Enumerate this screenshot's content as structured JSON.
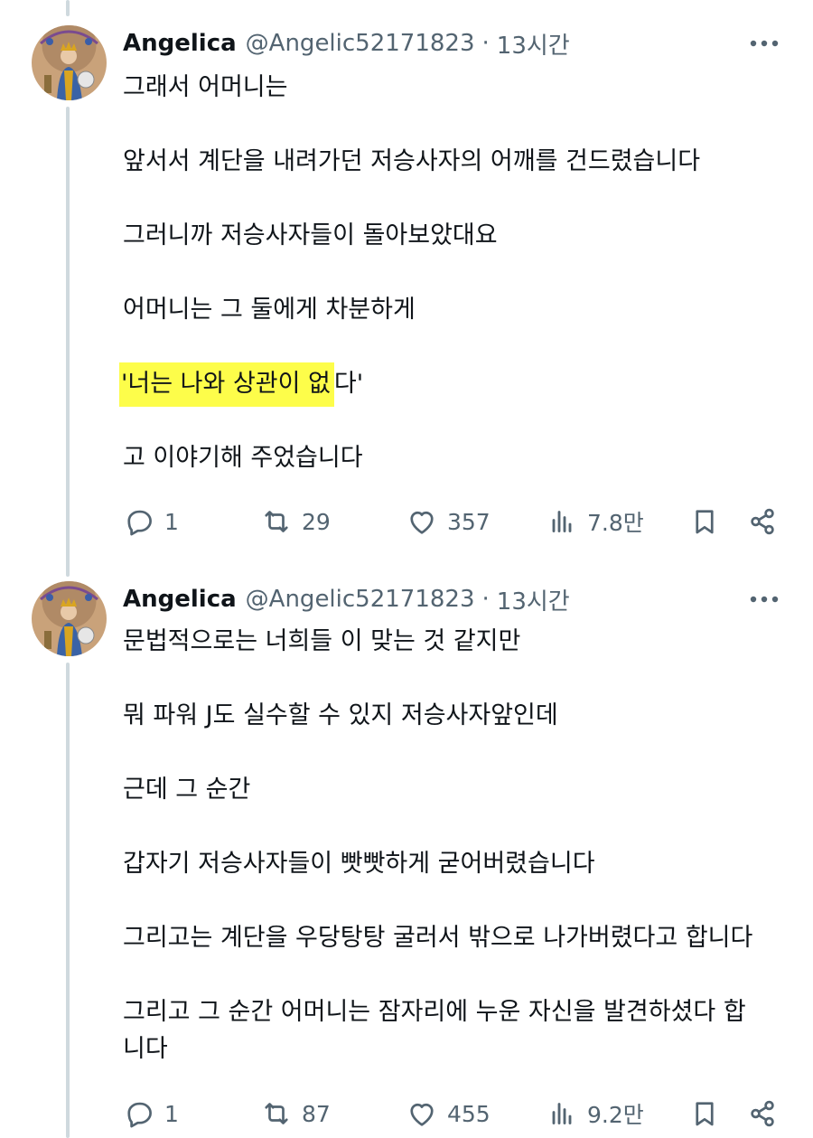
{
  "tweets": [
    {
      "name": "Angelica",
      "handle": "@Angelic52171823",
      "separator": "·",
      "time": "13시간",
      "lines": [
        "그래서 어머니는",
        "",
        "앞서서 계단을 내려가던 저승사자의 어깨를 건드렸습니다",
        "",
        "그러니까 저승사자들이 돌아보았대요",
        "",
        "어머니는 그 둘에게 차분하게",
        "",
        "'너는 나와 상관이 없다'",
        "",
        "고 이야기해 주었습니다"
      ],
      "highlight_a": "'너는 나와 상관이 없",
      "highlight_b": "다'",
      "stats": {
        "replies": "1",
        "retweets": "29",
        "likes": "357",
        "views": "7.8만"
      }
    },
    {
      "name": "Angelica",
      "handle": "@Angelic52171823",
      "separator": "·",
      "time": "13시간",
      "lines": [
        "문법적으로는 너희들 이 맞는 것 같지만",
        "",
        "뭐 파워 J도 실수할 수 있지 저승사자앞인데",
        "",
        "근데 그 순간",
        "",
        "갑자기 저승사자들이 빳빳하게 굳어버렸습니다",
        "",
        "그리고는 계단을 우당탕탕 굴러서 밖으로 나가버렸다고 합니다",
        "",
        "그리고 그 순간 어머니는 잠자리에 누운 자신을 발견하셨다 합",
        "니다"
      ],
      "stats": {
        "replies": "1",
        "retweets": "87",
        "likes": "455",
        "views": "9.2만"
      }
    }
  ],
  "icons": {
    "more": "more-dots-icon",
    "reply": "reply-bubble-icon",
    "retweet": "retweet-icon",
    "like": "heart-icon",
    "views": "views-bar-icon",
    "bookmark": "bookmark-icon",
    "share": "share-icon"
  },
  "colors": {
    "text": "#0f1419",
    "secondary": "#536471",
    "highlight": "#fdfd4a",
    "thread_line": "#cfd9de"
  }
}
